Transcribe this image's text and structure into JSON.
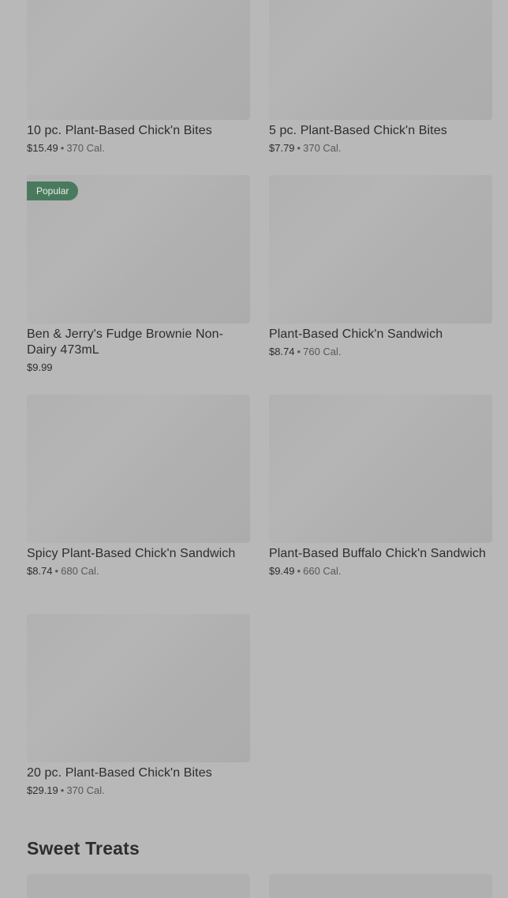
{
  "items": [
    {
      "title": "10 pc. Plant-Based Chick'n Bites",
      "price": "$15.49",
      "calories": "370 Cal."
    },
    {
      "title": "5 pc. Plant-Based Chick'n Bites",
      "price": "$7.79",
      "calories": "370 Cal."
    },
    {
      "title": "Ben & Jerry's Fudge Brownie Non-Dairy 473mL",
      "price": "$9.99",
      "badge": "Popular"
    },
    {
      "title": "Plant-Based Chick'n Sandwich",
      "price": "$8.74",
      "calories": "760 Cal."
    },
    {
      "title": "Spicy Plant-Based Chick'n Sandwich",
      "price": "$8.74",
      "calories": "680 Cal."
    },
    {
      "title": "Plant-Based Buffalo Chick'n Sandwich",
      "price": "$9.49",
      "calories": "660 Cal."
    },
    {
      "title": "20 pc. Plant-Based Chick'n Bites",
      "price": "$29.19",
      "calories": "370 Cal."
    }
  ],
  "sections": {
    "sweet_treats_title": "Sweet Treats"
  },
  "separator": "•"
}
